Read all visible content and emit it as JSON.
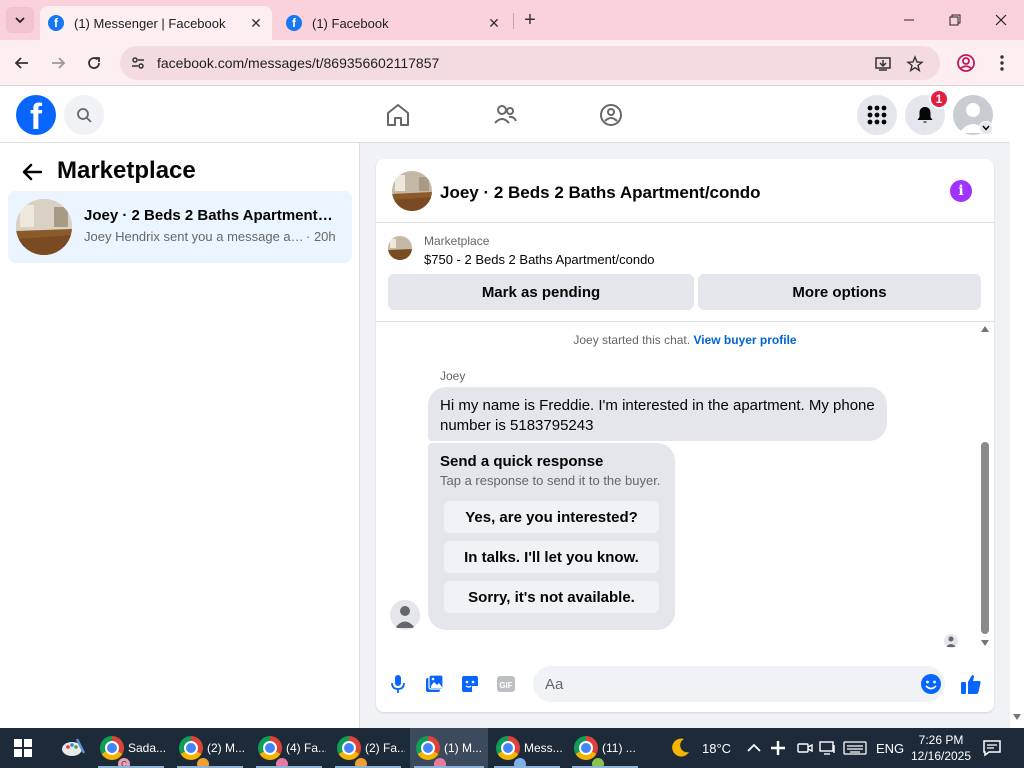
{
  "browser": {
    "tabs": [
      {
        "title": "(1) Messenger | Facebook",
        "active": true
      },
      {
        "title": "(1) Facebook",
        "active": false
      }
    ],
    "url": "facebook.com/messages/t/869356602117857"
  },
  "colors": {
    "facebook_blue": "#0866ff",
    "link_blue": "#0064d1",
    "info_purple": "#a033ff",
    "badge_red": "#e41e3f",
    "tab_strip": "#f9d2dc",
    "taskbar": "#1c2a3a"
  },
  "header": {
    "notification_count": "1"
  },
  "left": {
    "title": "Marketplace",
    "conversations": [
      {
        "title": "Joey · 2 Beds 2 Baths Apartment/condo",
        "snippet": "Joey Hendrix sent you a message about",
        "time": "· 20h"
      }
    ]
  },
  "chat": {
    "title": "Joey · 2 Beds 2 Baths Apartment/condo",
    "listing": {
      "category": "Marketplace",
      "name": "$750 - 2 Beds 2 Baths Apartment/condo"
    },
    "buttons": {
      "pending": "Mark as pending",
      "more": "More options"
    },
    "system": {
      "text": "Joey started this chat.",
      "link": "View buyer profile"
    },
    "sender": "Joey",
    "message": "Hi my name is Freddie. I'm interested in the apartment. My phone number is 5183795243",
    "quick": {
      "title": "Send a quick response",
      "subtitle": "Tap a response to send it to the buyer.",
      "options": [
        "Yes, are you interested?",
        "In talks. I'll let you know.",
        "Sorry, it's not available."
      ]
    },
    "composer_placeholder": "Aa"
  },
  "taskbar": {
    "items": [
      {
        "label": "Sada...",
        "badge": "C"
      },
      {
        "label": "(2) M...",
        "badge": ""
      },
      {
        "label": "(4) Fa...",
        "badge": ""
      },
      {
        "label": "(2) Fa...",
        "badge": ""
      },
      {
        "label": "(1) M...",
        "badge": ""
      },
      {
        "label": "Mess...",
        "badge": ""
      },
      {
        "label": "(11) ...",
        "badge": ""
      }
    ],
    "weather": "18°C",
    "language": "ENG",
    "time": "7:26 PM",
    "date": "12/16/2025"
  }
}
